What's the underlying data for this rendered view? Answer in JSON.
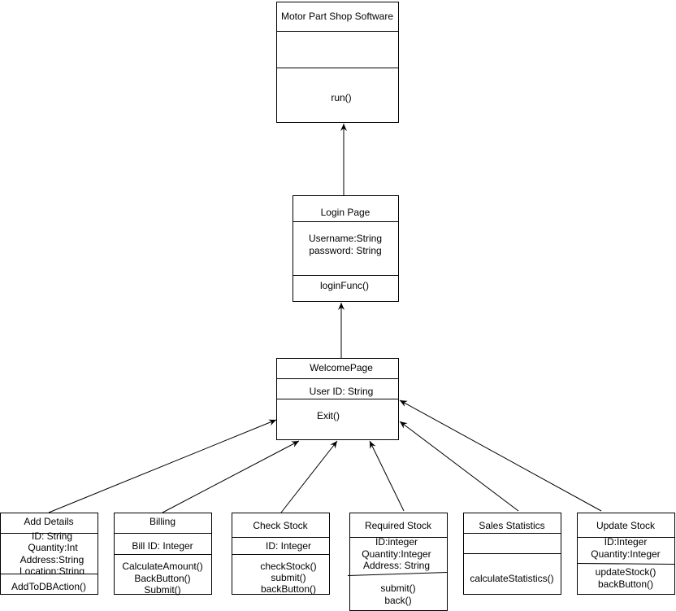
{
  "classes": {
    "motor": {
      "name": "Motor Part Shop Software",
      "attributes": [],
      "methods": [
        "run()"
      ]
    },
    "login": {
      "name": "Login Page",
      "attributes": [
        "Username:String",
        "password: String"
      ],
      "methods": [
        "loginFunc()"
      ]
    },
    "welcome": {
      "name": "WelcomePage",
      "attributes": [
        "User ID: String"
      ],
      "methods": [
        "Exit()"
      ]
    },
    "add": {
      "name": "Add Details",
      "attributes": [
        "ID: String",
        "Quantity:Int",
        "Address:String",
        "Location:String"
      ],
      "methods": [
        "AddToDBAction()"
      ]
    },
    "billing": {
      "name": "Billing",
      "attributes": [
        "Bill ID: Integer"
      ],
      "methods": [
        "CalculateAmount()",
        "BackButton()",
        "Submit()"
      ]
    },
    "check": {
      "name": "Check Stock",
      "attributes": [
        "ID: Integer"
      ],
      "methods": [
        "checkStock()",
        "submit()",
        "backButton()"
      ]
    },
    "required": {
      "name": "Required Stock",
      "attributes": [
        "ID:integer",
        "Quantity:Integer",
        "Address: String"
      ],
      "methods": [
        "submit()",
        "back()"
      ]
    },
    "sales": {
      "name": "Sales Statistics",
      "attributes": [],
      "methods": [
        "calculateStatistics()"
      ]
    },
    "update": {
      "name": "Update Stock",
      "attributes": [
        "ID:Integer",
        "Quantity:Integer"
      ],
      "methods": [
        "updateStock()",
        "backButton()"
      ]
    }
  },
  "relations": [
    {
      "from": "login",
      "to": "motor"
    },
    {
      "from": "welcome",
      "to": "login"
    },
    {
      "from": "add",
      "to": "welcome"
    },
    {
      "from": "billing",
      "to": "welcome"
    },
    {
      "from": "check",
      "to": "welcome"
    },
    {
      "from": "required",
      "to": "welcome"
    },
    {
      "from": "sales",
      "to": "welcome"
    },
    {
      "from": "update",
      "to": "welcome"
    }
  ]
}
